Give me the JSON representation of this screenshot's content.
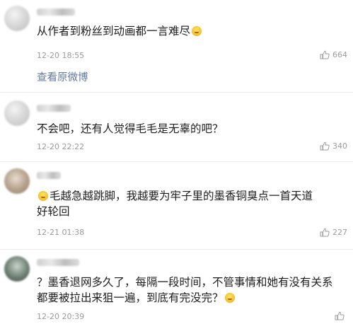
{
  "comments": [
    {
      "text": "从作者到粉丝到动画都一言难尽",
      "time": "12-20 18:55",
      "likes": "664",
      "has_emoji_end": true
    },
    {
      "text": "不会吧，还有人觉得毛毛是无辜的吧？",
      "time": "12-20 22:22",
      "likes": "340"
    },
    {
      "text": "毛越急越跳脚，我越要为牢子里的墨香铜臭点一首天道好轮回",
      "time": "12-21 01:38",
      "likes": "227",
      "has_emoji_start": true
    },
    {
      "text": "？墨香退网多久了，每隔一段时间，不管事情和她有没有关系都要被拉出来狙一遍，到底有完没完？",
      "time": "12-20 20:39",
      "likes": "",
      "has_emoji_end": true
    }
  ],
  "view_original_link": "查看原微博",
  "icons": {
    "like": "thumbs-up-icon",
    "emoji": "emoji-icon"
  }
}
